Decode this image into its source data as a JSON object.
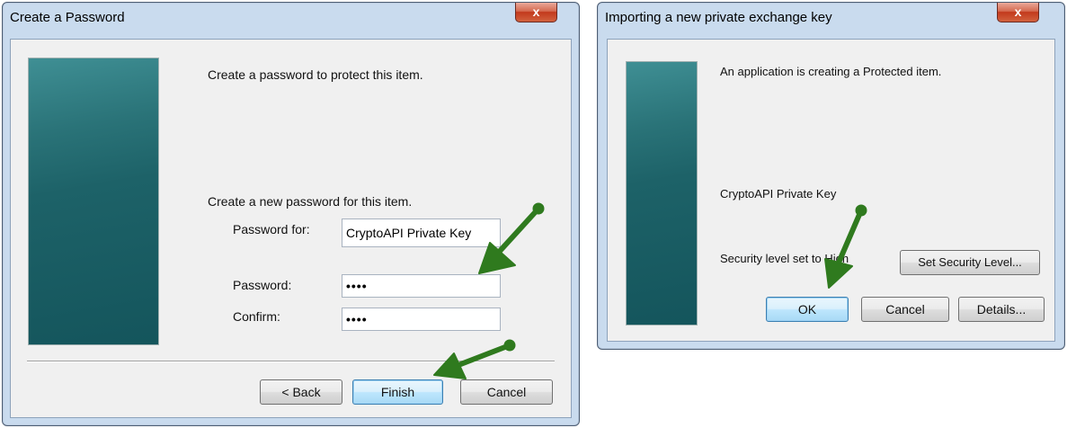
{
  "colors": {
    "arrow": "#2f7a1e",
    "banner": "#1d6268"
  },
  "left_dialog": {
    "title": "Create a Password",
    "close": "x",
    "intro": "Create a password to protect this item.",
    "section_label": "Create a new password for this item.",
    "password_for_label": "Password for:",
    "password_for_value": "CryptoAPI Private Key",
    "password_label": "Password:",
    "password_value": "••••",
    "confirm_label": "Confirm:",
    "confirm_value": "••••",
    "back_button": "< Back",
    "finish_button": "Finish",
    "cancel_button": "Cancel"
  },
  "right_dialog": {
    "title": "Importing a new private exchange key",
    "close": "x",
    "message": "An application is creating a Protected item.",
    "item_name": "CryptoAPI Private Key",
    "security_level_text": "Security level set to High",
    "set_security_button": "Set Security Level...",
    "ok_button": "OK",
    "cancel_button": "Cancel",
    "details_button": "Details..."
  }
}
